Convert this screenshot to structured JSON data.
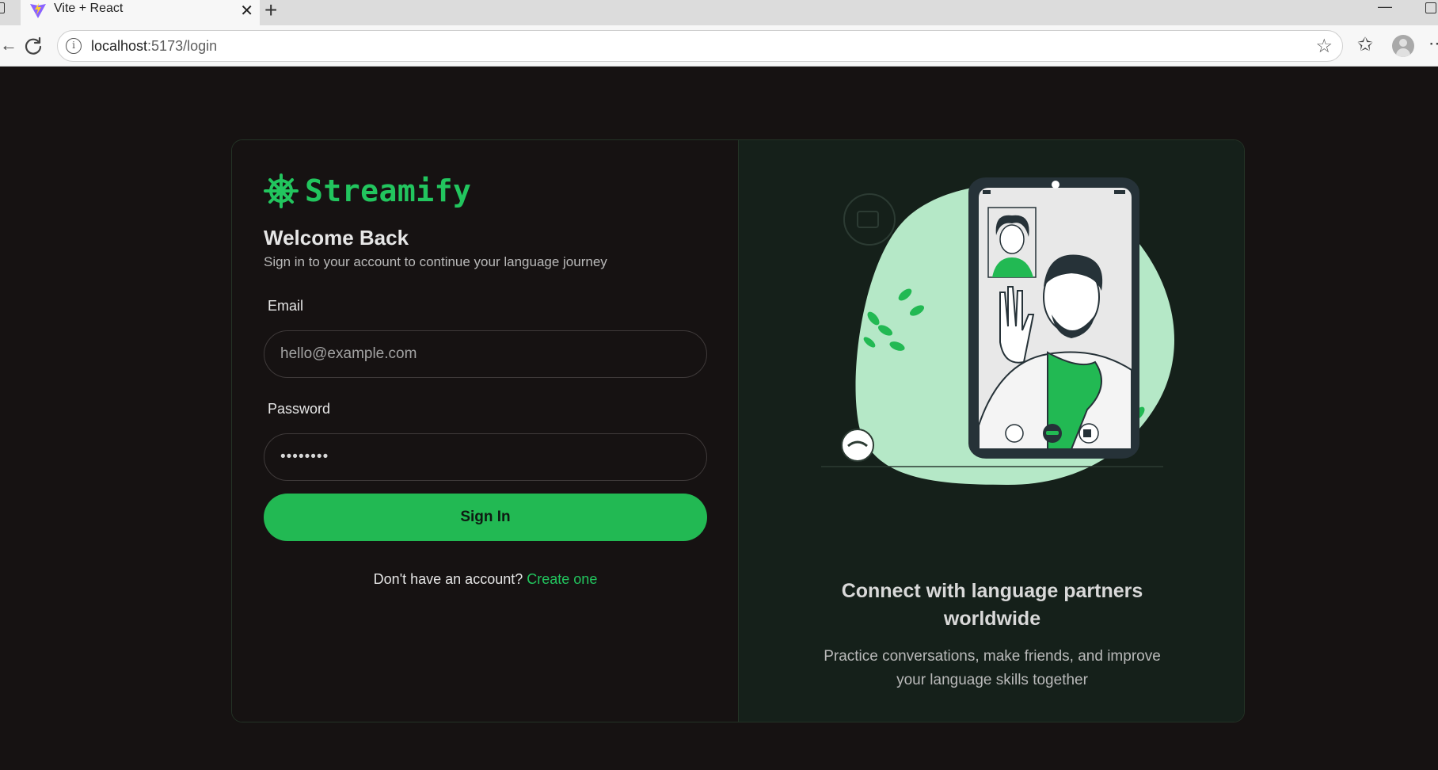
{
  "browser": {
    "tab_title": "Vite + React",
    "url_host": "localhost",
    "url_rest": ":5173/login"
  },
  "brand": {
    "name": "Streamify",
    "accent": "#22c55e"
  },
  "login": {
    "title": "Welcome Back",
    "subtitle": "Sign in to your account to continue your language journey",
    "email_label": "Email",
    "email_placeholder": "hello@example.com",
    "password_label": "Password",
    "password_value": "••••••••",
    "submit_label": "Sign In",
    "signup_prompt": "Don't have an account?",
    "signup_link": "Create one"
  },
  "promo": {
    "title": "Connect with language partners worldwide",
    "subtitle": "Practice conversations, make friends, and improve your language skills together"
  },
  "icons": [
    "vite-logo-icon",
    "close-icon",
    "plus-icon",
    "reload-icon",
    "info-icon",
    "star-icon",
    "favorites-icon",
    "profile-icon",
    "ship-wheel-icon"
  ]
}
